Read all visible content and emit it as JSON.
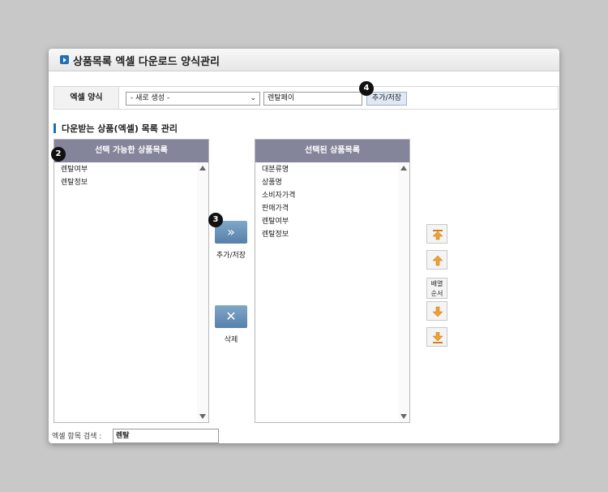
{
  "header": {
    "title": "상품목록 엑셀 다운로드 양식관리"
  },
  "form": {
    "label": "엑셀 양식",
    "select_value": "- 새로 생성 -",
    "input_value": "렌탈페이",
    "save_label": "추가/저장"
  },
  "section": {
    "title": "다운받는 상품(엑셀) 목록 관리"
  },
  "available": {
    "header": "선택 가능한 상품목록",
    "items": [
      "렌탈여부",
      "렌탈정보"
    ]
  },
  "selected": {
    "header": "선택된 상품목록",
    "items": [
      "대분류명",
      "상품명",
      "소비자가격",
      "판매가격",
      "렌탈여부",
      "렌탈정보"
    ]
  },
  "actions": {
    "add_label": "추가/저장",
    "add_icon": "double-chevron-right",
    "delete_label": "삭제",
    "delete_icon": "x"
  },
  "order": {
    "label_line1": "배열",
    "label_line2": "순서"
  },
  "search": {
    "label": "엑셀 항목 검색 :",
    "value": "렌탈"
  },
  "badges": {
    "b2": "2",
    "b3": "3",
    "b4": "4"
  },
  "colors": {
    "list_header": "#84849a",
    "accent": "#1f6fb8",
    "button": "#5681a8",
    "order_arrow": "#f0a030"
  }
}
